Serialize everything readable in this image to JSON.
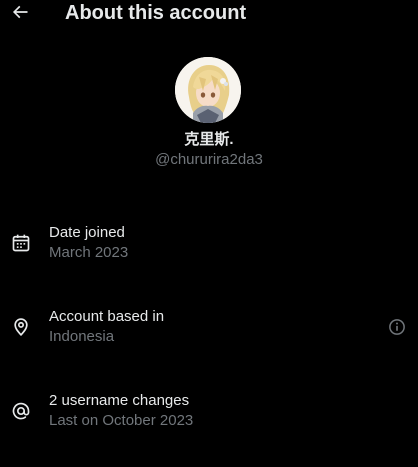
{
  "header": {
    "title": "About this account",
    "back_icon": "arrow-left-icon"
  },
  "profile": {
    "display_name": "克里斯.",
    "handle": "@chururira2da3",
    "avatar": "anime-character-avatar"
  },
  "rows": [
    {
      "icon": "calendar-icon",
      "title": "Date joined",
      "subtitle": "March 2023"
    },
    {
      "icon": "location-pin-icon",
      "title": "Account based in",
      "subtitle": "Indonesia",
      "trailing_icon": "info-icon"
    },
    {
      "icon": "at-sign-icon",
      "title": "2 username changes",
      "subtitle": "Last on October 2023"
    }
  ],
  "colors": {
    "background": "#000000",
    "primary_text": "#e7e9ea",
    "secondary_text": "#71767b"
  }
}
